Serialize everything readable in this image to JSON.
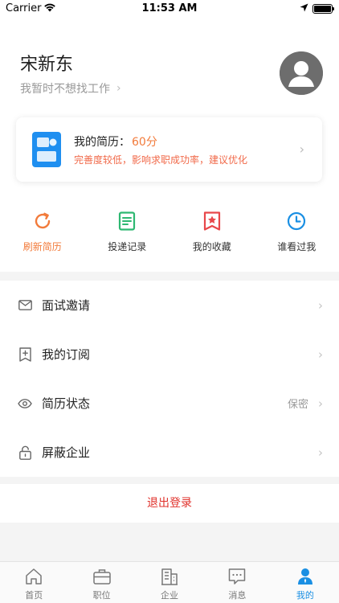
{
  "status_bar": {
    "carrier": "Carrier",
    "time": "11:53 AM"
  },
  "profile": {
    "name": "宋新东",
    "job_status": "我暂时不想找工作"
  },
  "resume_card": {
    "title": "我的简历：",
    "score": "60分",
    "hint": "完善度较低，影响求职成功率，建议优化"
  },
  "quick_actions": [
    {
      "label": "刷新简历",
      "icon": "refresh-icon"
    },
    {
      "label": "投递记录",
      "icon": "delivery-record-icon"
    },
    {
      "label": "我的收藏",
      "icon": "favorites-icon"
    },
    {
      "label": "谁看过我",
      "icon": "clock-icon"
    }
  ],
  "menu": [
    {
      "label": "面试邀请",
      "value": "",
      "icon": "mail-icon"
    },
    {
      "label": "我的订阅",
      "value": "",
      "icon": "subscribe-icon"
    },
    {
      "label": "简历状态",
      "value": "保密",
      "icon": "eye-icon"
    },
    {
      "label": "屏蔽企业",
      "value": "",
      "icon": "lock-icon"
    }
  ],
  "logout": {
    "label": "退出登录"
  },
  "tabbar": [
    {
      "label": "首页",
      "icon": "home-icon"
    },
    {
      "label": "职位",
      "icon": "briefcase-icon"
    },
    {
      "label": "企业",
      "icon": "building-icon"
    },
    {
      "label": "消息",
      "icon": "message-icon"
    },
    {
      "label": "我的",
      "icon": "user-icon"
    }
  ],
  "colors": {
    "accent_orange": "#f27b3b",
    "warning_red": "#e0312b",
    "active_blue": "#1a8fe3"
  }
}
